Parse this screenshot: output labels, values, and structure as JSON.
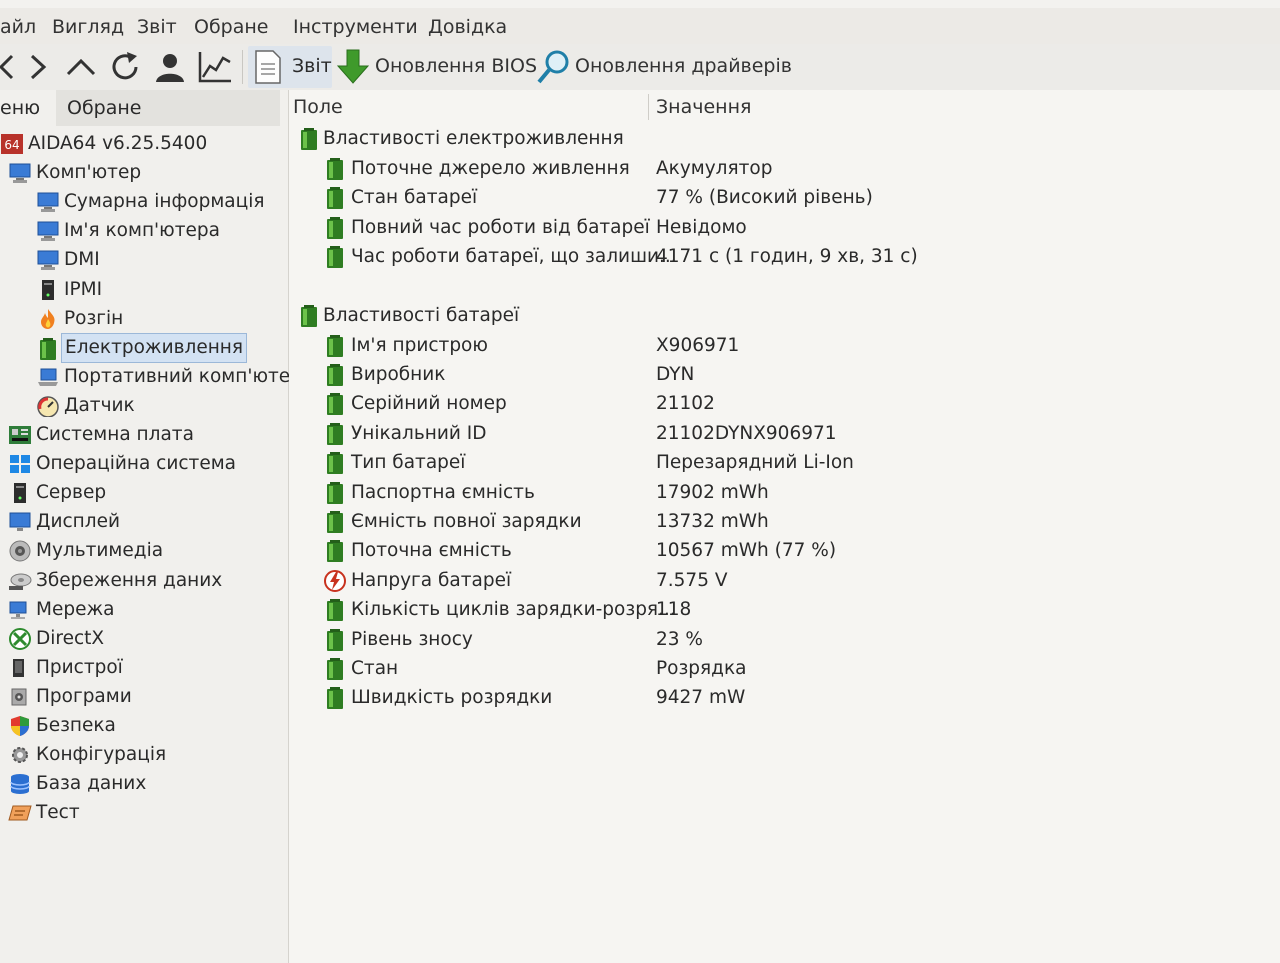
{
  "menubar": {
    "items": [
      "айл",
      "Вигляд",
      "Звіт",
      "Обране",
      "Інструменти",
      "Довідка"
    ]
  },
  "toolbar": {
    "report_label": "Звіт",
    "bios_update_label": "Оновлення BIOS",
    "driver_update_label": "Оновлення драйверів",
    "icons": [
      "chevron-left-icon",
      "chevron-right-icon",
      "chevron-up-icon",
      "refresh-icon",
      "user-icon",
      "chart-line-icon",
      "report-document-icon",
      "download-arrow-icon",
      "magnifier-icon"
    ]
  },
  "left_panel": {
    "tabs": [
      "еню",
      "Обране"
    ],
    "tree": [
      {
        "label": "AIDA64 v6.25.5400",
        "icon": "aida64-app-icon"
      },
      {
        "label": "Комп'ютер",
        "icon": "computer-icon"
      },
      {
        "label": "Сумарна інформація",
        "icon": "computer-icon"
      },
      {
        "label": "Ім'я комп'ютера",
        "icon": "computer-icon"
      },
      {
        "label": "DMI",
        "icon": "computer-icon"
      },
      {
        "label": "IPMI",
        "icon": "server-tower-icon"
      },
      {
        "label": "Розгін",
        "icon": "flame-icon"
      },
      {
        "label": "Електроживлення",
        "icon": "battery-icon",
        "selected": true
      },
      {
        "label": "Портативний комп'юте",
        "icon": "laptop-icon"
      },
      {
        "label": "Датчик",
        "icon": "gauge-icon"
      },
      {
        "label": "Системна плата",
        "icon": "motherboard-icon"
      },
      {
        "label": "Операційна система",
        "icon": "windows-logo-icon"
      },
      {
        "label": "Сервер",
        "icon": "server-tower-icon"
      },
      {
        "label": "Дисплей",
        "icon": "monitor-icon"
      },
      {
        "label": "Мультимедіа",
        "icon": "speaker-icon"
      },
      {
        "label": "Збереження даних",
        "icon": "storage-disk-icon"
      },
      {
        "label": "Мережа",
        "icon": "network-icon"
      },
      {
        "label": "DirectX",
        "icon": "xbox-logo-icon"
      },
      {
        "label": "Пристрої",
        "icon": "devices-icon"
      },
      {
        "label": "Програми",
        "icon": "programs-icon"
      },
      {
        "label": "Безпека",
        "icon": "shield-icon"
      },
      {
        "label": "Конфігурація",
        "icon": "configuration-icon"
      },
      {
        "label": "База даних",
        "icon": "database-icon"
      },
      {
        "label": "Тест",
        "icon": "benchmark-icon"
      }
    ]
  },
  "right_panel": {
    "columns": {
      "field": "Поле",
      "value": "Значення"
    },
    "groups": [
      {
        "title": "Властивості електроживлення",
        "rows": [
          {
            "field": "Поточне джерело живлення",
            "value": "Акумулятор",
            "icon": "battery-icon"
          },
          {
            "field": "Стан батареї",
            "value": "77 % (Високий рівень)",
            "icon": "battery-icon"
          },
          {
            "field": "Повний час роботи від батареї",
            "value": "Невідомо",
            "icon": "battery-icon"
          },
          {
            "field": "Час роботи батареї, що залиши...",
            "value": "4171 с (1 годин, 9 хв, 31 с)",
            "icon": "battery-icon"
          }
        ]
      },
      {
        "title": "Властивості батареї",
        "rows": [
          {
            "field": "Ім'я пристрою",
            "value": "X906971",
            "icon": "battery-icon"
          },
          {
            "field": "Виробник",
            "value": "DYN",
            "icon": "battery-icon"
          },
          {
            "field": "Серійний номер",
            "value": "21102",
            "icon": "battery-icon"
          },
          {
            "field": "Унікальний ID",
            "value": "21102DYNX906971",
            "icon": "battery-icon"
          },
          {
            "field": "Тип батареї",
            "value": "Перезарядний Li-Ion",
            "icon": "battery-icon"
          },
          {
            "field": "Паспортна ємність",
            "value": "17902 mWh",
            "icon": "battery-icon"
          },
          {
            "field": "Ємність повної зарядки",
            "value": "13732 mWh",
            "icon": "battery-icon"
          },
          {
            "field": "Поточна ємність",
            "value": "10567 mWh  (77 %)",
            "icon": "battery-icon"
          },
          {
            "field": "Напруга батареї",
            "value": "7.575 V",
            "icon": "voltage-icon"
          },
          {
            "field": "Кількість циклів зарядки-розря...",
            "value": "118",
            "icon": "battery-icon"
          },
          {
            "field": "Рівень зносу",
            "value": "23 %",
            "icon": "battery-icon"
          },
          {
            "field": "Стан",
            "value": "Розрядка",
            "icon": "battery-icon"
          },
          {
            "field": "Швидкість розрядки",
            "value": "9427 mW",
            "icon": "battery-icon"
          }
        ]
      }
    ]
  },
  "colors": {
    "battery_green": "#3f8f2a",
    "selection_bg": "#d3e2f3",
    "selection_border": "#9cb8d8",
    "voltage_red": "#c8321e"
  }
}
